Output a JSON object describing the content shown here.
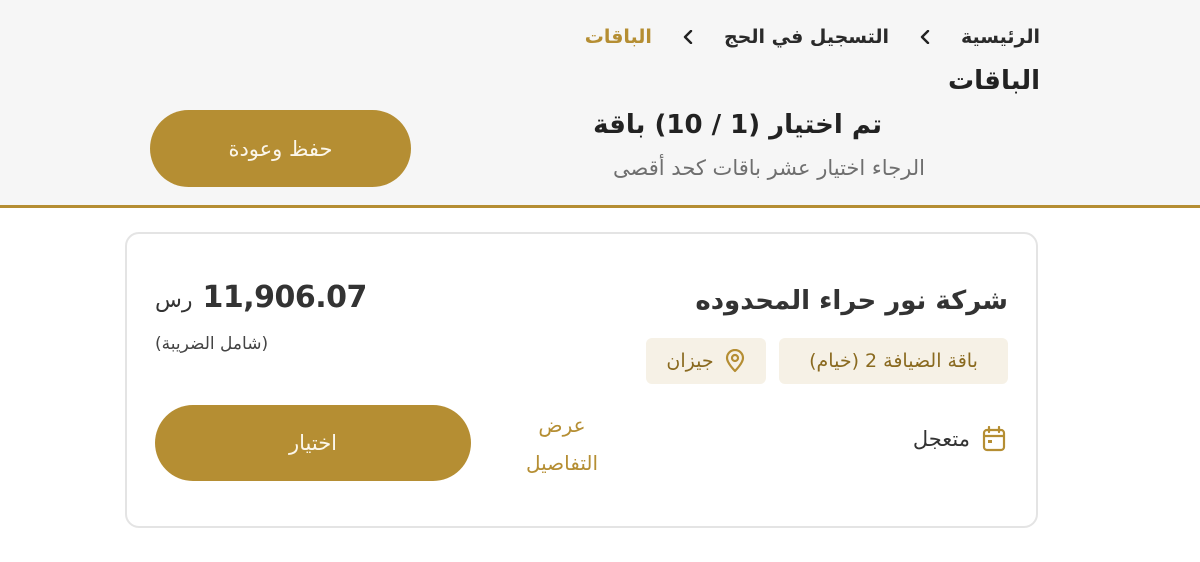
{
  "breadcrumb": {
    "home": "الرئيسية",
    "hajj_registration": "التسجيل في الحج",
    "current": "الباقات"
  },
  "page": {
    "title": "الباقات"
  },
  "selection": {
    "title": "تم اختيار (1 / 10) باقة",
    "hint": "الرجاء اختيار عشر باقات كحد أقصى"
  },
  "actions": {
    "save_back_label": "حفظ وعودة"
  },
  "package_card": {
    "company_name": "شركة نور حراء المحدوده",
    "package_name": "باقة الضيافة 2 (خيام)",
    "city": "جيزان",
    "price": "11,906.07",
    "currency": "رس",
    "price_note": "(شامل الضريبة)",
    "arrival_type": "متعجل",
    "details_label": "عرض التفاصيل",
    "select_label": "اختيار"
  },
  "colors": {
    "accent": "#b58e33",
    "tag_background": "#f6f1e6",
    "header_background": "#f6f6f6"
  },
  "icons": {
    "breadcrumb_separator": "chevron-left-icon",
    "city": "location-pin-icon",
    "arrival": "calendar-icon"
  }
}
